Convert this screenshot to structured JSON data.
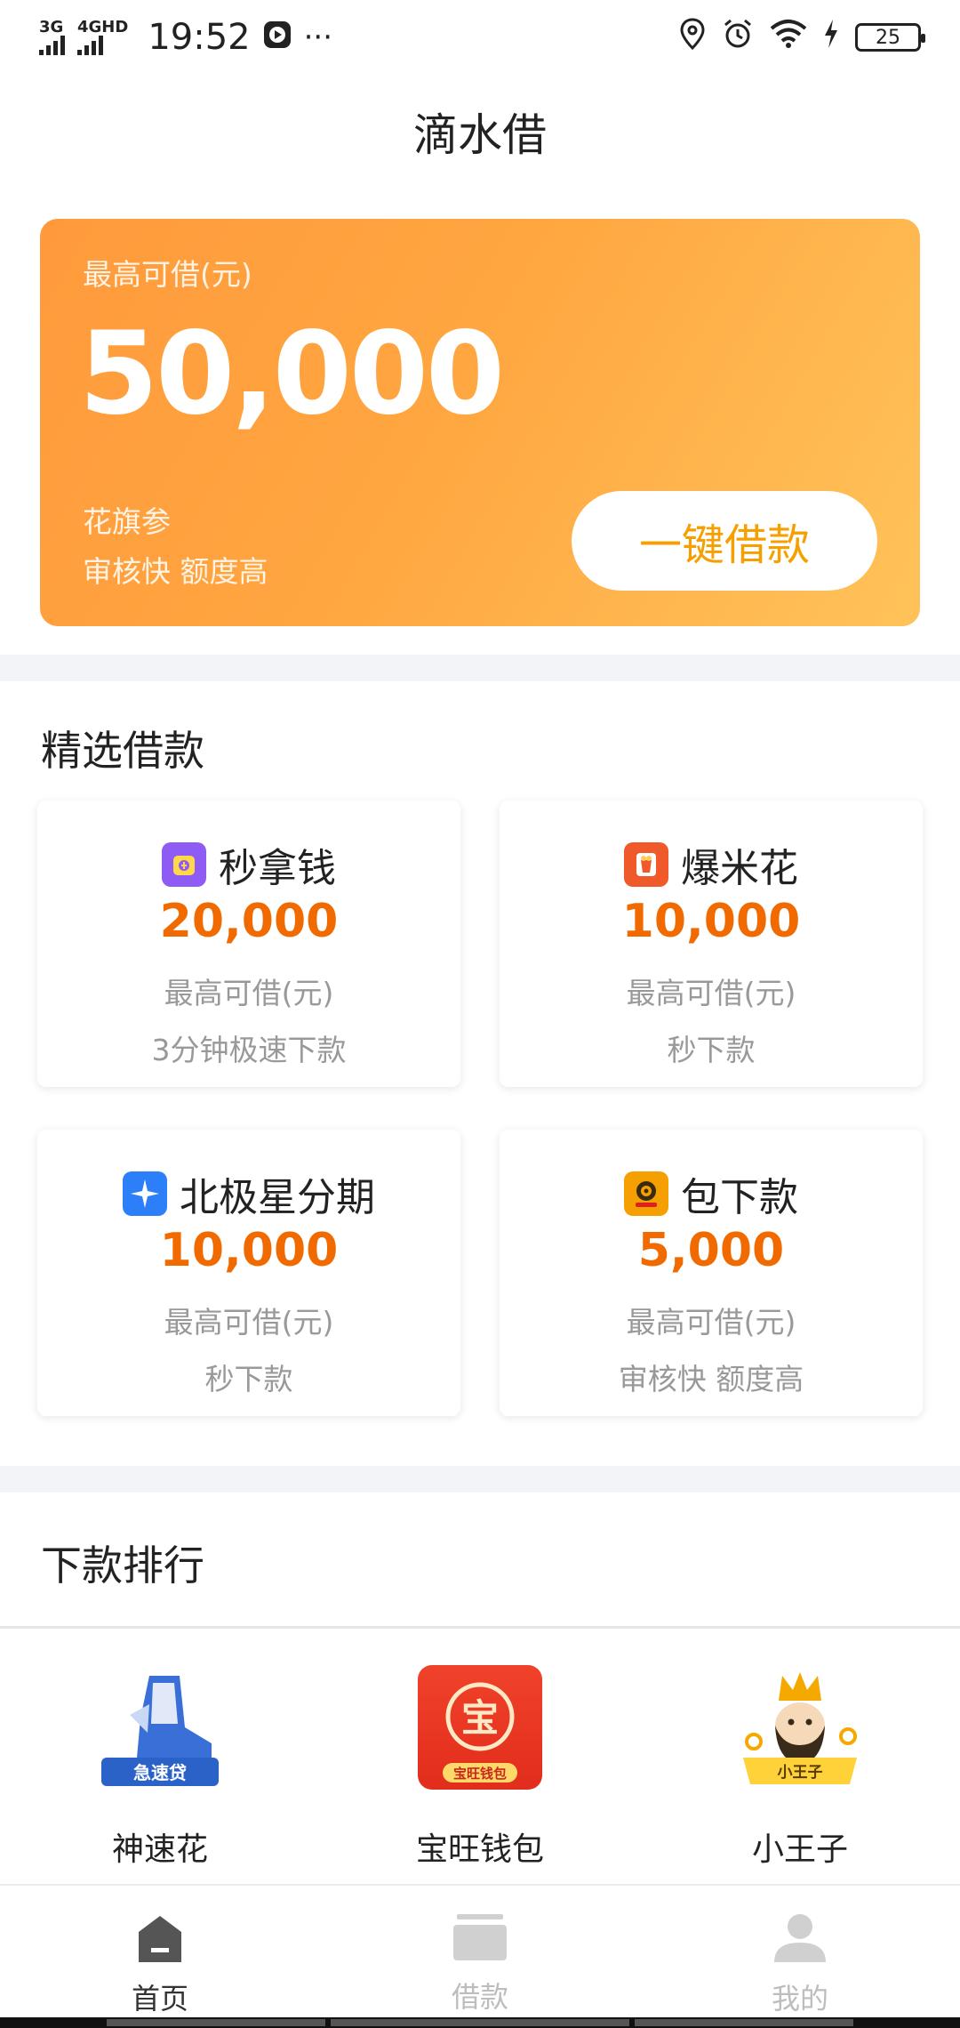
{
  "status_bar": {
    "network1": "3G",
    "network2": "4GHD",
    "time": "19:52",
    "more": "···",
    "battery": "25"
  },
  "header": {
    "title": "滴水借"
  },
  "hero": {
    "label": "最高可借(元)",
    "amount": "50,000",
    "brand": "花旗参",
    "tagline": "审核快 额度高",
    "button": "一键借款"
  },
  "featured": {
    "title": "精选借款",
    "cards": [
      {
        "name": "秒拿钱",
        "amount": "20,000",
        "label": "最高可借(元)",
        "desc": "3分钟极速下款",
        "icon": "wallet-icon",
        "color": "#8e5cf5"
      },
      {
        "name": "爆米花",
        "amount": "10,000",
        "label": "最高可借(元)",
        "desc": "秒下款",
        "icon": "popcorn-icon",
        "color": "#f05a2a"
      },
      {
        "name": "北极星分期",
        "amount": "10,000",
        "label": "最高可借(元)",
        "desc": "秒下款",
        "icon": "star-icon",
        "color": "#2d7ff9"
      },
      {
        "name": "包下款",
        "amount": "5,000",
        "label": "最高可借(元)",
        "desc": "审核快 额度高",
        "icon": "coin-icon",
        "color": "#f5a000"
      }
    ]
  },
  "ranking": {
    "title": "下款排行",
    "apps": [
      {
        "name": "神速花",
        "badge": "急速贷",
        "icon": "boot-icon"
      },
      {
        "name": "宝旺钱包",
        "badge": "宝旺钱包",
        "glyph": "宝",
        "icon": "treasure-icon"
      },
      {
        "name": "小王子",
        "badge": "小王子",
        "icon": "prince-icon"
      }
    ]
  },
  "nav": {
    "home": "首页",
    "loan": "借款",
    "mine": "我的"
  },
  "colors": {
    "accent": "#f5a000",
    "amount": "#f06a00",
    "hero_start": "#ff9a3c",
    "hero_end": "#ffc35a"
  }
}
